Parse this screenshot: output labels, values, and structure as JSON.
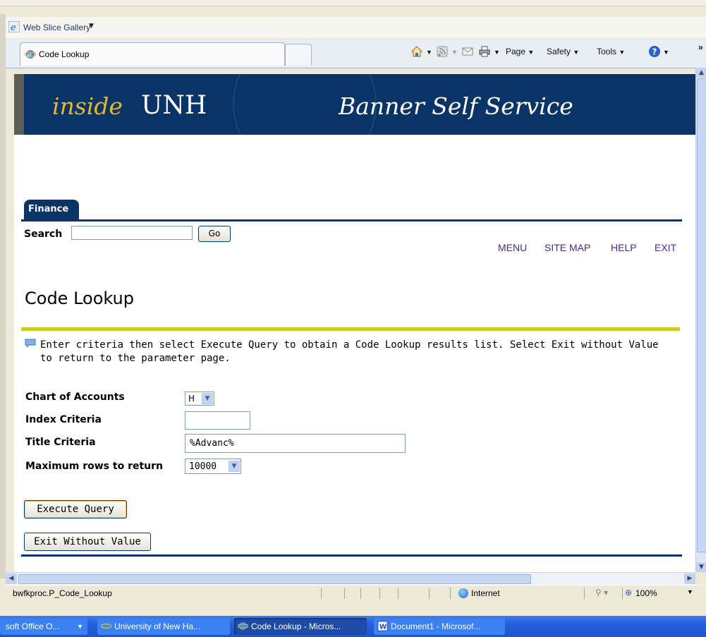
{
  "favorites": {
    "label": "Web Slice Gallery"
  },
  "tab": {
    "title": "Code Lookup"
  },
  "toolbar": {
    "page": "Page",
    "safety": "Safety",
    "tools": "Tools",
    "chevron": "»"
  },
  "banner": {
    "inside": "inside",
    "unh": "UNH",
    "service": "Banner Self Service"
  },
  "nav": {
    "tab_label": "Finance",
    "search_label": "Search",
    "go_label": "Go",
    "links": [
      "MENU",
      "SITE MAP",
      "HELP",
      "EXIT"
    ]
  },
  "page": {
    "title": "Code Lookup",
    "instructions": "Enter criteria then select Execute Query to obtain a Code Lookup results list. Select Exit without Value to return to the parameter page."
  },
  "form": {
    "chart_label": "Chart of Accounts",
    "chart_value": "H",
    "index_label": "Index Criteria",
    "index_value": "",
    "title_label": "Title Criteria",
    "title_value": "%Advanc%",
    "max_label": "Maximum rows to return",
    "max_value": "10000",
    "execute_label": "Execute Query",
    "exit_label": "Exit Without Value"
  },
  "status": {
    "url": "bwfkproc.P_Code_Lookup",
    "zone": "Internet",
    "zoom": "100%"
  },
  "taskbar": {
    "items": [
      "soft Office O...",
      "University of New Ha...",
      "Code Lookup - Micros...",
      "Document1 - Microsof..."
    ]
  },
  "colors": {
    "banner": "#0a3467",
    "accent_line": "#cccc1f",
    "link": "#4e1fa8",
    "banner_gold": "#e3b92a"
  }
}
